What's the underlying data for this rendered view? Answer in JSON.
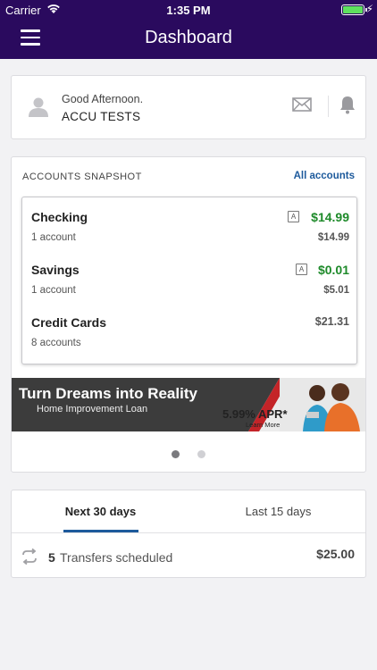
{
  "status_bar": {
    "carrier": "Carrier",
    "time": "1:35 PM",
    "battery_level": 1.0
  },
  "nav": {
    "title": "Dashboard",
    "menu_icon": "hamburger-icon"
  },
  "greeting": {
    "message": "Good Afternoon.",
    "user_name": "ACCU TESTS",
    "icons": [
      "avatar-icon",
      "mail-icon",
      "bell-icon"
    ]
  },
  "snapshot": {
    "title": "ACCOUNTS SNAPSHOT",
    "all_accounts_link": "All accounts",
    "accounts": [
      {
        "name": "Checking",
        "count": "1 account",
        "badge": "A",
        "value": "$14.99",
        "sub_value": "$14.99"
      },
      {
        "name": "Savings",
        "count": "1 account",
        "badge": "A",
        "value": "$0.01",
        "sub_value": "$5.01"
      },
      {
        "name": "Credit Cards",
        "count": "8 accounts",
        "value": "$21.31"
      }
    ],
    "banner": {
      "headline": "Turn Dreams into Reality",
      "subline": "Home Improvement Loan",
      "apr": "5.99% APR*",
      "cta": "Learn More"
    },
    "carousel": {
      "page_count": 2,
      "active_index": 0
    }
  },
  "transfers": {
    "tabs": [
      "Next 30 days",
      "Last 15 days"
    ],
    "active_tab": 0,
    "count": "5",
    "label": "Transfers scheduled",
    "amount": "$25.00"
  },
  "colors": {
    "nav_bg": "#2a0a5e",
    "positive": "#1e8a2a",
    "link": "#1d5a9c",
    "banner_red": "#c42428"
  }
}
